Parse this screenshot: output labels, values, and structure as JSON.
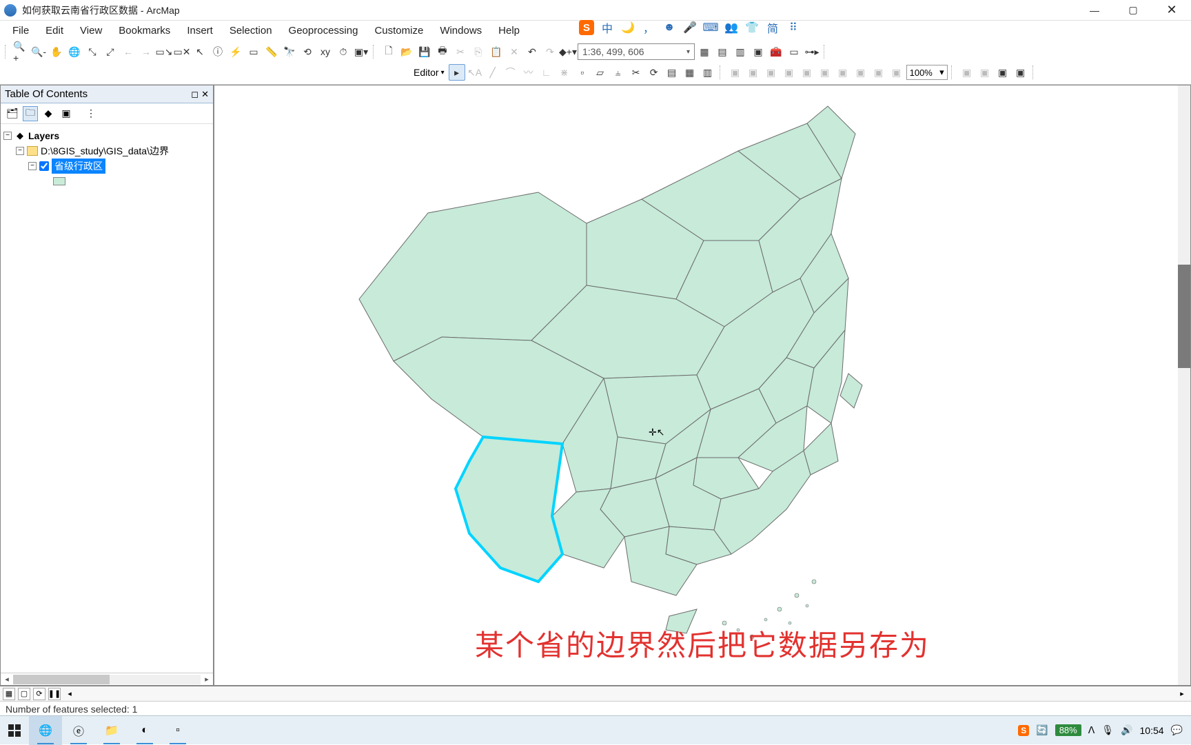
{
  "titlebar": {
    "title": "如何获取云南省行政区数据 - ArcMap"
  },
  "menu": [
    "File",
    "Edit",
    "View",
    "Bookmarks",
    "Insert",
    "Selection",
    "Geoprocessing",
    "Customize",
    "Windows",
    "Help"
  ],
  "sogou": {
    "logo": "S",
    "cn": "中",
    "moon": "🌙",
    "comma": "，",
    "face": "☻",
    "mic": "🎤",
    "kbd": "⌨",
    "ppl": "👥",
    "shirt": "👕",
    "jian": "简",
    "grid": "⠿"
  },
  "toolbar1": {
    "scale": "1:36, 499, 606"
  },
  "toolbar2": {
    "editor_label": "Editor",
    "zoom_pct": "100%"
  },
  "toc": {
    "title": "Table Of Contents",
    "layers_label": "Layers",
    "data_path": "D:\\8GIS_study\\GIS_data\\边界",
    "layer_name": "省级行政区"
  },
  "map": {
    "caption": "某个省的边界然后把它数据另存为"
  },
  "statusbar": {
    "text": "Number of features selected: 1"
  },
  "taskbar": {
    "battery": "88%",
    "time": "10:54"
  }
}
